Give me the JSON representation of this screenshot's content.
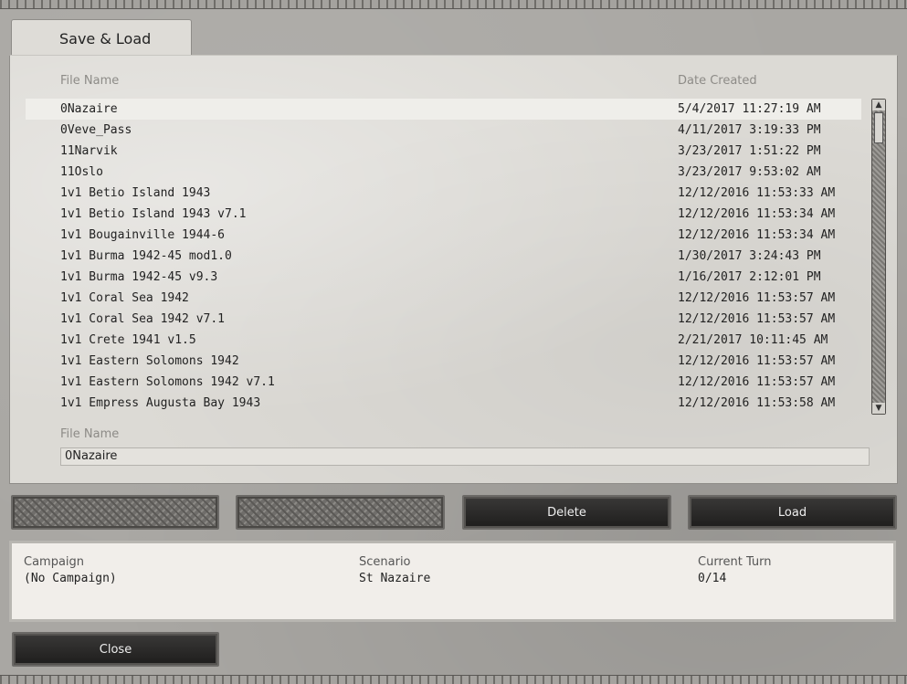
{
  "window": {
    "tab_title": "Save & Load"
  },
  "columns": {
    "file_name": "File Name",
    "date_created": "Date Created"
  },
  "files": [
    {
      "name": "0Nazaire",
      "date": "5/4/2017 11:27:19 AM",
      "selected": true
    },
    {
      "name": "0Veve_Pass",
      "date": "4/11/2017 3:19:33 PM"
    },
    {
      "name": "11Narvik",
      "date": "3/23/2017 1:51:22 PM"
    },
    {
      "name": "11Oslo",
      "date": "3/23/2017 9:53:02 AM"
    },
    {
      "name": "1v1 Betio Island 1943",
      "date": "12/12/2016 11:53:33 AM"
    },
    {
      "name": "1v1 Betio Island 1943 v7.1",
      "date": "12/12/2016 11:53:34 AM"
    },
    {
      "name": "1v1 Bougainville 1944-6",
      "date": "12/12/2016 11:53:34 AM"
    },
    {
      "name": "1v1 Burma 1942-45 mod1.0",
      "date": "1/30/2017 3:24:43 PM"
    },
    {
      "name": "1v1 Burma 1942-45 v9.3",
      "date": "1/16/2017 2:12:01 PM"
    },
    {
      "name": "1v1 Coral Sea 1942",
      "date": "12/12/2016 11:53:57 AM"
    },
    {
      "name": "1v1 Coral Sea 1942 v7.1",
      "date": "12/12/2016 11:53:57 AM"
    },
    {
      "name": "1v1 Crete 1941 v1.5",
      "date": "2/21/2017 10:11:45 AM"
    },
    {
      "name": "1v1 Eastern Solomons 1942",
      "date": "12/12/2016 11:53:57 AM"
    },
    {
      "name": "1v1 Eastern Solomons 1942 v7.1",
      "date": "12/12/2016 11:53:57 AM"
    },
    {
      "name": "1v1 Empress Augusta Bay 1943",
      "date": "12/12/2016 11:53:58 AM"
    }
  ],
  "file_name_field": {
    "label": "File Name",
    "value": "0Nazaire"
  },
  "buttons": {
    "delete": "Delete",
    "load": "Load",
    "close": "Close"
  },
  "info": {
    "campaign_label": "Campaign",
    "campaign_value": "(No Campaign)",
    "scenario_label": "Scenario",
    "scenario_value": "St Nazaire",
    "turn_label": "Current Turn",
    "turn_value": "0/14"
  },
  "icons": {
    "scroll_up": "up-arrow-icon",
    "scroll_down": "down-arrow-icon"
  }
}
